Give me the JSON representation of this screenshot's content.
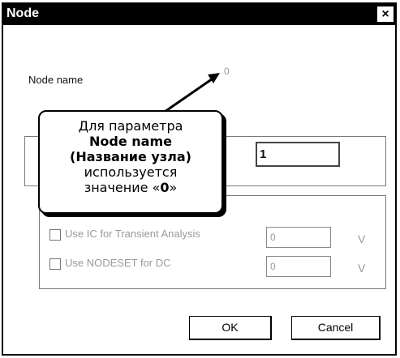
{
  "dialog": {
    "title": "Node",
    "close_glyph": "×"
  },
  "fields": {
    "node_name_label": "Node name",
    "node_name_value": "0",
    "number_value": "1"
  },
  "options": {
    "ic_label": "Use IC for Transient Analysis",
    "ic_value": "0",
    "ic_unit": "V",
    "nodeset_label": "Use NODESET for DC",
    "nodeset_value": "0",
    "nodeset_unit": "V"
  },
  "buttons": {
    "ok": "OK",
    "cancel": "Cancel"
  },
  "callout": {
    "line1": "Для параметра",
    "line2": "Node name",
    "line3": "(Название узла)",
    "line4": "используется",
    "line5_prefix": "значение «",
    "line5_value": "0",
    "line5_suffix": "»"
  }
}
